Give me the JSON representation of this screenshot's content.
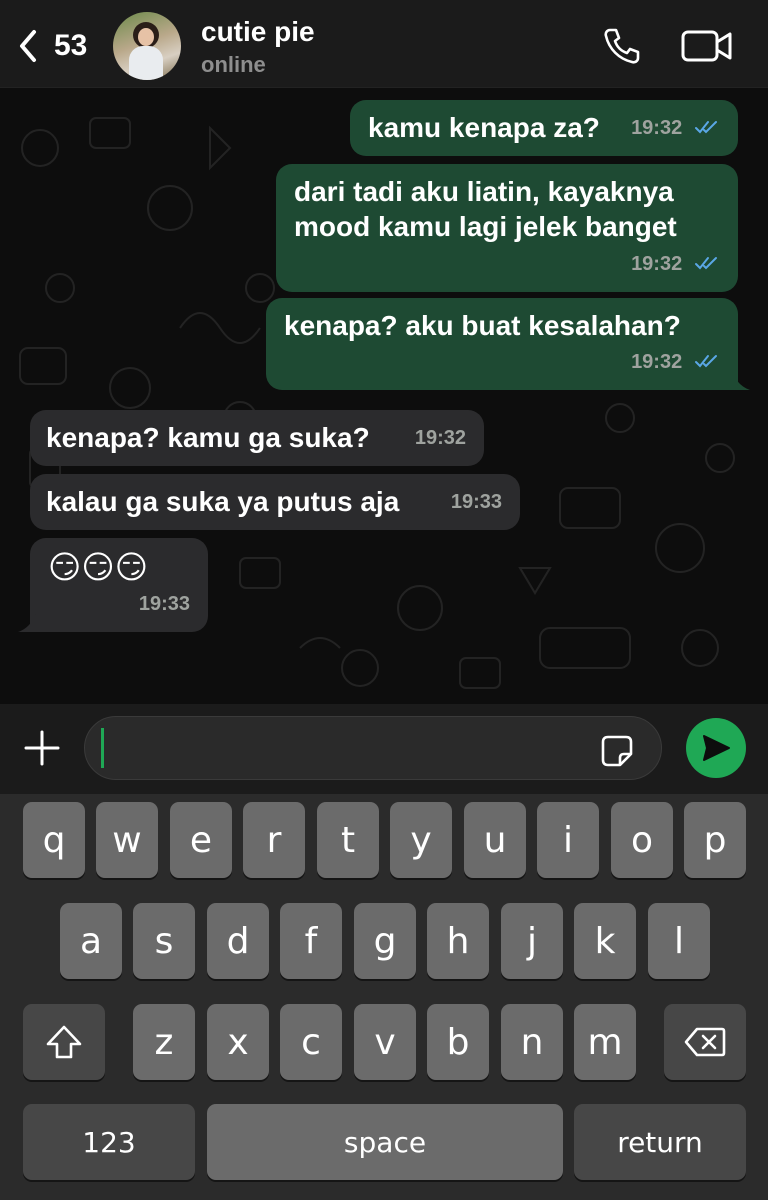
{
  "header": {
    "back_count": "53",
    "contact_name": "cutie pie",
    "contact_status": "online",
    "icons": {
      "back": "chevron-left-icon",
      "call": "phone-icon",
      "video": "video-camera-icon"
    }
  },
  "messages": [
    {
      "direction": "outgoing",
      "text": "kamu kenapa za?",
      "time": "19:32",
      "read": true
    },
    {
      "direction": "outgoing",
      "text_lines": [
        "dari tadi aku liatin, kayaknya",
        "mood kamu lagi jelek banget"
      ],
      "time": "19:32",
      "read": true
    },
    {
      "direction": "outgoing",
      "text": "kenapa? aku buat kesalahan?",
      "time": "19:32",
      "read": true
    },
    {
      "direction": "incoming",
      "text": "kenapa? kamu ga suka?",
      "time": "19:32"
    },
    {
      "direction": "incoming",
      "text": "kalau ga suka ya putus aja",
      "time": "19:33"
    },
    {
      "direction": "incoming",
      "text": "😏😏😏",
      "time": "19:33"
    }
  ],
  "composer": {
    "value": "",
    "icons": {
      "attach": "plus-icon",
      "sticker": "sticker-icon",
      "send": "send-icon"
    }
  },
  "colors": {
    "outgoing_bubble": "#1e4a33",
    "incoming_bubble": "#2b2b2d",
    "accent_green": "#1fa855",
    "read_ticks": "#5aa7e6"
  },
  "keyboard": {
    "row1": [
      "q",
      "w",
      "e",
      "r",
      "t",
      "y",
      "u",
      "i",
      "o",
      "p"
    ],
    "row2": [
      "a",
      "s",
      "d",
      "f",
      "g",
      "h",
      "j",
      "k",
      "l"
    ],
    "row3": [
      "z",
      "x",
      "c",
      "v",
      "b",
      "n",
      "m"
    ],
    "numbers_label": "123",
    "space_label": "space",
    "return_label": "return",
    "icons": {
      "shift": "shift-icon",
      "delete": "backspace-icon"
    }
  }
}
